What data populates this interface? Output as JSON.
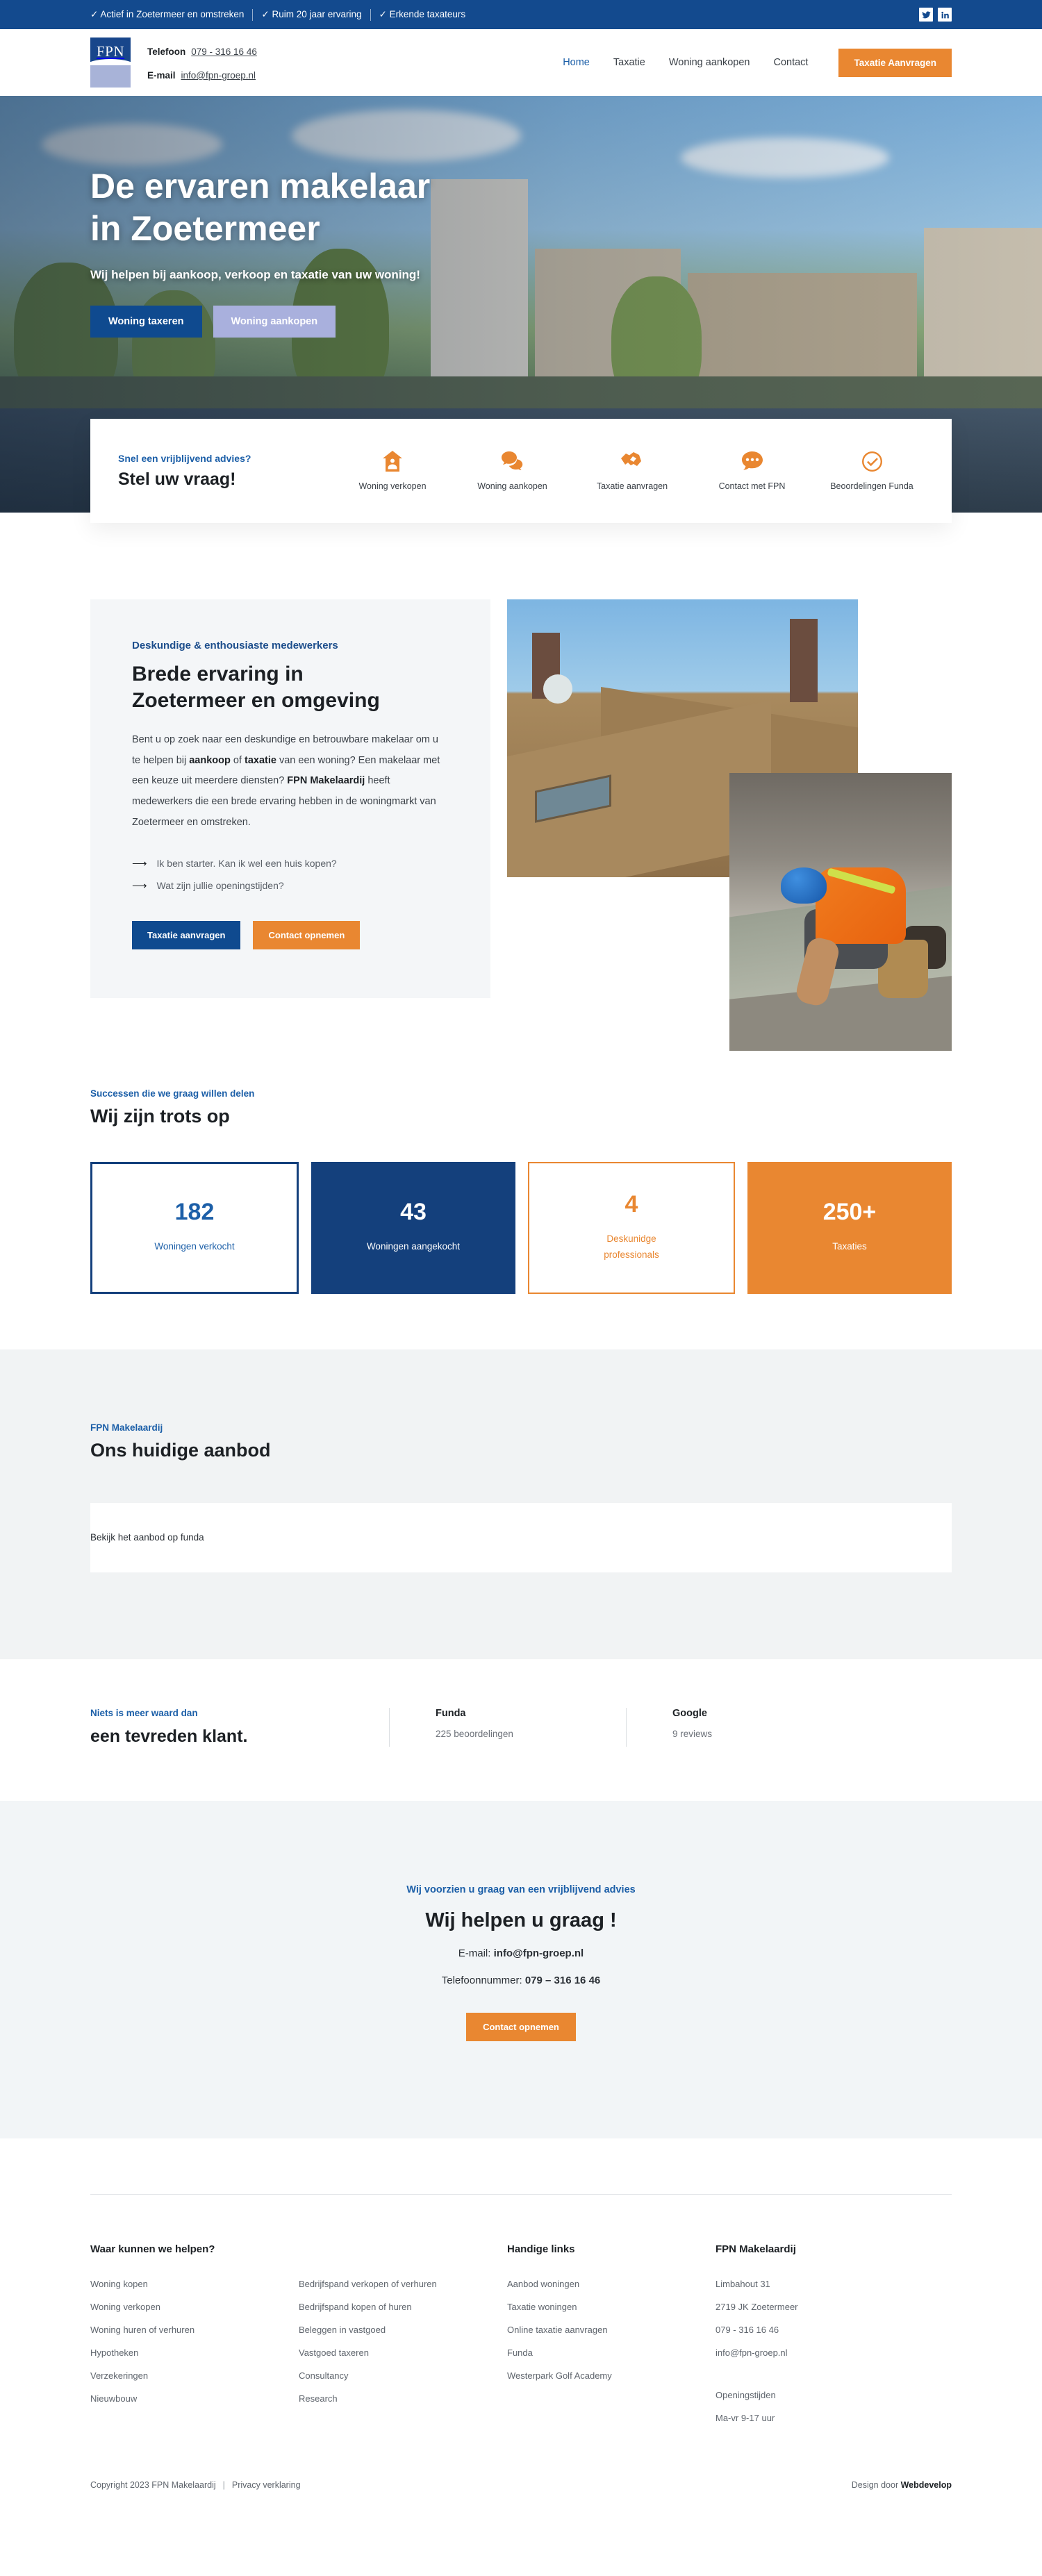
{
  "topbar": {
    "usps": [
      "✓ Actief in Zoetermeer en omstreken",
      "✓ Ruim 20 jaar ervaring",
      "✓ Erkende taxateurs"
    ],
    "socials": [
      {
        "name": "twitter-icon",
        "label": "Twitter"
      },
      {
        "name": "linkedin-icon",
        "label": "LinkedIn"
      }
    ]
  },
  "header": {
    "logo_text": "FPN",
    "phone_label": "Telefoon",
    "phone_value": "079 - 316 16 46",
    "email_label": "E-mail",
    "email_value": "info@fpn-groep.nl",
    "nav": [
      {
        "label": "Home",
        "active": true
      },
      {
        "label": "Taxatie",
        "active": false
      },
      {
        "label": "Woning aankopen",
        "active": false
      },
      {
        "label": "Contact",
        "active": false
      }
    ],
    "cta_label": "Taxatie Aanvragen"
  },
  "hero": {
    "title_line1": "De ervaren makelaar",
    "title_line2": "in Zoetermeer",
    "subtitle": "Wij helpen bij aankoop, verkoop en taxatie van uw woning!",
    "button_primary": "Woning taxeren",
    "button_secondary": "Woning aankopen"
  },
  "quicklinks": {
    "eyebrow": "Snel een vrijblijvend advies?",
    "title": "Stel uw vraag!",
    "items": [
      {
        "icon": "house-person-icon",
        "label": "Woning verkopen"
      },
      {
        "icon": "chat-bubbles-icon",
        "label": "Woning aankopen"
      },
      {
        "icon": "handshake-icon",
        "label": "Taxatie aanvragen"
      },
      {
        "icon": "chat-dots-icon",
        "label": "Contact met FPN"
      },
      {
        "icon": "check-circle-icon",
        "label": "Beoordelingen Funda"
      }
    ]
  },
  "about": {
    "eyebrow": "Deskundige & enthousiaste medewerkers",
    "heading_line1": "Brede ervaring in",
    "heading_line2": "Zoetermeer en omgeving",
    "paragraph_part1": "Bent u op zoek naar een deskundige en betrouwbare makelaar om u te helpen bij ",
    "paragraph_bold1": "aankoop",
    "paragraph_part2": " of ",
    "paragraph_bold2": "taxatie",
    "paragraph_part3": " van een woning? Een makelaar met een keuze uit meerdere diensten? ",
    "paragraph_bold3": "FPN Makelaardij",
    "paragraph_part4": " heeft medewerkers die een brede ervaring hebben in de woningmarkt van Zoetermeer en omstreken.",
    "links": [
      "Ik ben starter. Kan ik wel een huis kopen?",
      "Wat zijn jullie openingstijden?"
    ],
    "button_primary": "Taxatie aanvragen",
    "button_secondary": "Contact opnemen",
    "images": [
      {
        "name": "roof-photo",
        "alt": "Dak van een woning met schoorsteen"
      },
      {
        "name": "worker-photo",
        "alt": "Dakdekker aan het werk met blauwe helm"
      }
    ]
  },
  "stats": {
    "eyebrow": "Successen die we graag willen delen",
    "title": "Wij zijn trots op",
    "items": [
      {
        "number": "182",
        "label": "Woningen verkocht",
        "variant": "v-outline-blue"
      },
      {
        "number": "43",
        "label": "Woningen aangekocht",
        "variant": "v-solid-blue"
      },
      {
        "number": "4",
        "label": "Deskunidge professionals",
        "variant": "v-outline-orange"
      },
      {
        "number": "250+",
        "label": "Taxaties",
        "variant": "v-solid-orange"
      }
    ]
  },
  "aanbod": {
    "eyebrow": "FPN Makelaardij",
    "title": "Ons huidige aanbod",
    "link_label": "Bekijk het aanbod op funda"
  },
  "reviews": {
    "eyebrow": "Niets is meer waard dan",
    "title": "een tevreden klant.",
    "items": [
      {
        "name": "Funda",
        "count": "225 beoordelingen"
      },
      {
        "name": "Google",
        "count": "9 reviews"
      }
    ]
  },
  "cta": {
    "eyebrow": "Wij voorzien u graag van een vrijblijvend advies",
    "title": "Wij helpen u graag !",
    "email_prefix": "E-mail: ",
    "email_value": "info@fpn-groep.nl",
    "phone_prefix": "Telefoonnummer: ",
    "phone_value": "079 – 316 16 46",
    "button_label": "Contact opnemen"
  },
  "footer": {
    "help": {
      "heading": "Waar kunnen we helpen?",
      "column1": [
        "Woning kopen",
        "Woning verkopen",
        "Woning huren of verhuren",
        "Hypotheken",
        "Verzekeringen",
        "Nieuwbouw"
      ],
      "column2": [
        "Bedrijfspand verkopen of verhuren",
        "Bedrijfspand kopen of huren",
        "Beleggen in vastgoed",
        "Vastgoed taxeren",
        "Consultancy",
        "Research"
      ]
    },
    "links": {
      "heading": "Handige links",
      "items": [
        "Aanbod woningen",
        "Taxatie woningen",
        "Online taxatie aanvragen",
        "Funda",
        "Westerpark Golf Academy"
      ]
    },
    "company": {
      "heading": "FPN Makelaardij",
      "address_line1": "Limbahout 31",
      "address_line2": "2719 JK Zoetermeer",
      "phone": "079 - 316 16 46",
      "email": "info@fpn-groep.nl",
      "hours_label": "Openingstijden",
      "hours_value": "Ma-vr 9-17 uur"
    },
    "bottom": {
      "copyright": "Copyright 2023 FPN Makelaardij",
      "separator": "|",
      "privacy": "Privacy verklaring",
      "design_prefix": "Design door ",
      "design_by": "Webdevelop"
    }
  },
  "colors": {
    "brand_blue": "#134a8e",
    "deep_blue": "#14407c",
    "accent_orange": "#e98731",
    "lilac": "#a9b0dd",
    "light_grey": "#f1f3f4"
  }
}
